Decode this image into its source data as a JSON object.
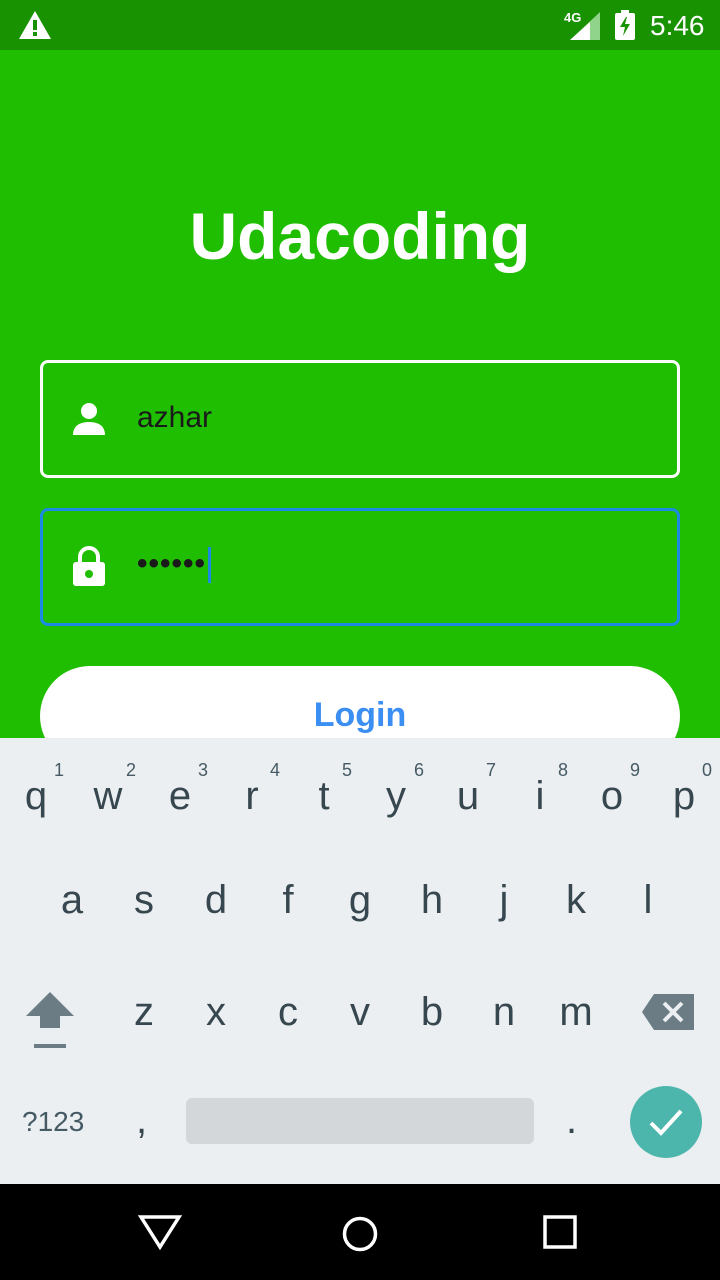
{
  "status_bar": {
    "network": "4G",
    "time": "5:46",
    "icons": [
      "warning-icon",
      "signal-icon",
      "battery-charging-icon"
    ]
  },
  "app": {
    "title": "Udacoding",
    "username": {
      "value": "azhar",
      "icon": "person-icon"
    },
    "password": {
      "value": "••••••",
      "icon": "lock-icon"
    },
    "login_label": "Login",
    "colors": {
      "background": "#1fbe00",
      "focus_border": "#1e88e5",
      "login_text": "#3b8ef2"
    }
  },
  "keyboard": {
    "row1": [
      {
        "ch": "q",
        "num": "1"
      },
      {
        "ch": "w",
        "num": "2"
      },
      {
        "ch": "e",
        "num": "3"
      },
      {
        "ch": "r",
        "num": "4"
      },
      {
        "ch": "t",
        "num": "5"
      },
      {
        "ch": "y",
        "num": "6"
      },
      {
        "ch": "u",
        "num": "7"
      },
      {
        "ch": "i",
        "num": "8"
      },
      {
        "ch": "o",
        "num": "9"
      },
      {
        "ch": "p",
        "num": "0"
      }
    ],
    "row2": [
      "a",
      "s",
      "d",
      "f",
      "g",
      "h",
      "j",
      "k",
      "l"
    ],
    "row3": [
      "z",
      "x",
      "c",
      "v",
      "b",
      "n",
      "m"
    ],
    "symbols_label": "?123",
    "comma": ",",
    "period": ".",
    "accent": "#4db6ac"
  },
  "nav_bar": {
    "icons": [
      "back-icon",
      "home-icon",
      "recents-icon"
    ]
  }
}
